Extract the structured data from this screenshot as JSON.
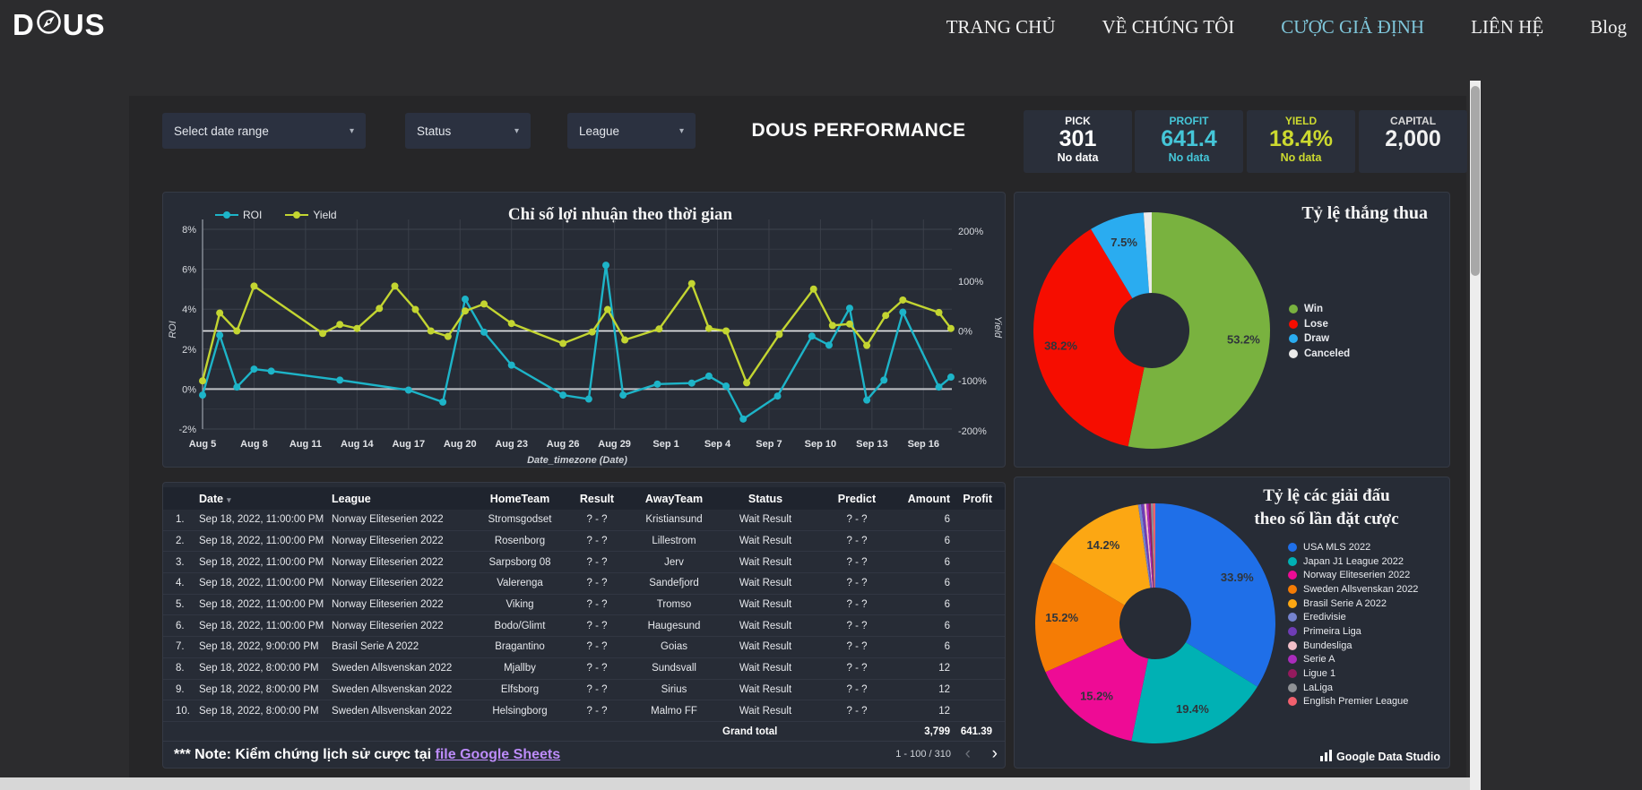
{
  "nav": {
    "logo_prefix": "D",
    "logo_suffix": "US",
    "items": [
      {
        "label": "TRANG CHỦ",
        "active": false
      },
      {
        "label": "VỀ CHÚNG TÔI",
        "active": false
      },
      {
        "label": "CƯỢC GIẢ ĐỊNH",
        "active": true
      },
      {
        "label": "LIÊN HỆ",
        "active": false
      },
      {
        "label": "Blog",
        "active": false
      }
    ]
  },
  "filters": [
    {
      "label": "Select date range",
      "caret": "▾"
    },
    {
      "label": "Status",
      "caret": "▾"
    },
    {
      "label": "League",
      "caret": "▾"
    }
  ],
  "dashboard_title": "DOUS PERFORMANCE",
  "kpis": [
    {
      "label": "PICK",
      "value": "301",
      "sub": "No data",
      "label_color": "#f4f4f4",
      "value_color": "#ffffff"
    },
    {
      "label": "PROFIT",
      "value": "641.4",
      "sub": "No data",
      "label_color": "#45c6d8",
      "value_color": "#45c6d8"
    },
    {
      "label": "YIELD",
      "value": "18.4%",
      "sub": "No data",
      "label_color": "#ccd92f",
      "value_color": "#ccd92f"
    },
    {
      "label": "CAPITAL",
      "value": "2,000",
      "sub": "",
      "label_color": "#d9d9d9",
      "value_color": "#f1f1f1"
    }
  ],
  "chart_data": [
    {
      "type": "line",
      "title": "Chỉ số lợi nhuận theo thời gian",
      "xlabel": "Date_timezone (Date)",
      "x_ticks": [
        "Aug 5",
        "Aug 8",
        "Aug 11",
        "Aug 14",
        "Aug 17",
        "Aug 20",
        "Aug 23",
        "Aug 26",
        "Aug 29",
        "Sep 1",
        "Sep 4",
        "Sep 7",
        "Sep 10",
        "Sep 13",
        "Sep 16"
      ],
      "x_tick_step_days": 3,
      "left_axis": {
        "label": "ROI",
        "tick_labels": [
          "8%",
          "6%",
          "4%",
          "2%",
          "0%",
          "-2%"
        ],
        "tick_values": [
          8,
          6,
          4,
          2,
          0,
          -2
        ],
        "min": -2,
        "max": 8
      },
      "right_axis": {
        "label": "Yield",
        "tick_labels": [
          "200%",
          "100%",
          "0%",
          "-100%",
          "-200%"
        ],
        "tick_values": [
          200,
          100,
          0,
          -100,
          -200
        ],
        "min": -200,
        "max": 200
      },
      "grid": true,
      "legend_position": "top-left",
      "series": [
        {
          "name": "ROI",
          "axis": "left",
          "color": "#1db4c8",
          "points": [
            [
              0,
              -0.3
            ],
            [
              1,
              2.7
            ],
            [
              2,
              0.1
            ],
            [
              3,
              1.0
            ],
            [
              4,
              0.9
            ],
            [
              8,
              0.45
            ],
            [
              12,
              -0.05
            ],
            [
              14,
              -0.65
            ],
            [
              15.3,
              4.5
            ],
            [
              16.4,
              2.85
            ],
            [
              18,
              1.2
            ],
            [
              21,
              -0.3
            ],
            [
              22.5,
              -0.5
            ],
            [
              23.5,
              6.2
            ],
            [
              24.5,
              -0.3
            ],
            [
              26.5,
              0.25
            ],
            [
              28.5,
              0.3
            ],
            [
              29.5,
              0.65
            ],
            [
              30.5,
              0.15
            ],
            [
              31.5,
              -1.5
            ],
            [
              33.5,
              -0.35
            ],
            [
              35.5,
              2.65
            ],
            [
              36.5,
              2.2
            ],
            [
              37.7,
              4.05
            ],
            [
              38.7,
              -0.55
            ],
            [
              39.7,
              0.45
            ],
            [
              40.8,
              3.85
            ],
            [
              42.9,
              0.1
            ],
            [
              43.6,
              0.6
            ]
          ]
        },
        {
          "name": "Yield",
          "axis": "right",
          "color": "#c3d531",
          "points": [
            [
              0,
              -100
            ],
            [
              1,
              36
            ],
            [
              2,
              0
            ],
            [
              3,
              90
            ],
            [
              7,
              -5
            ],
            [
              8,
              13
            ],
            [
              9,
              5
            ],
            [
              10.3,
              45
            ],
            [
              11.2,
              90
            ],
            [
              12.4,
              43
            ],
            [
              13.3,
              0
            ],
            [
              14.3,
              -11
            ],
            [
              15.3,
              40
            ],
            [
              16.4,
              54
            ],
            [
              18,
              15
            ],
            [
              21,
              -25
            ],
            [
              22.7,
              -2
            ],
            [
              23.6,
              43
            ],
            [
              24.6,
              -18
            ],
            [
              26.6,
              4
            ],
            [
              28.5,
              95
            ],
            [
              29.5,
              5
            ],
            [
              30.5,
              0
            ],
            [
              31.7,
              -104
            ],
            [
              33.6,
              -7
            ],
            [
              35.6,
              84
            ],
            [
              36.7,
              11
            ],
            [
              37.7,
              14
            ],
            [
              38.7,
              -29
            ],
            [
              39.8,
              31
            ],
            [
              40.8,
              62
            ],
            [
              42.9,
              37
            ],
            [
              43.6,
              5
            ]
          ]
        }
      ]
    },
    {
      "type": "donut",
      "title": "Tỷ lệ thắng thua",
      "legend_position": "right",
      "label_min_pct": 5,
      "slices": [
        {
          "label": "Win",
          "value": 53.2,
          "pct_label": "53.2%",
          "color": "#79b23f"
        },
        {
          "label": "Lose",
          "value": 38.2,
          "pct_label": "38.2%",
          "color": "#f60d00"
        },
        {
          "label": "Draw",
          "value": 7.5,
          "pct_label": "7.5%",
          "color": "#2aacf0"
        },
        {
          "label": "Canceled",
          "value": 1.1,
          "pct_label": "1.1%",
          "color": "#ebebeb"
        }
      ]
    },
    {
      "type": "donut",
      "title_lines": [
        "Tỷ lệ các giải đấu",
        "theo số lần đặt cược"
      ],
      "legend_position": "right",
      "label_min_pct": 5,
      "slices": [
        {
          "label": "USA MLS 2022",
          "value": 33.9,
          "pct_label": "33.9%",
          "color": "#1f6fe8"
        },
        {
          "label": "Japan J1 League 2022",
          "value": 19.4,
          "pct_label": "19.4%",
          "color": "#00b1b4"
        },
        {
          "label": "Norway Eliteserien 2022",
          "value": 15.2,
          "pct_label": "15.2%",
          "color": "#ee0b95"
        },
        {
          "label": "Sweden Allsvenskan 2022",
          "value": 15.2,
          "pct_label": "15.2%",
          "color": "#f57c05"
        },
        {
          "label": "Brasil Serie A 2022",
          "value": 14.2,
          "pct_label": "14.2%",
          "color": "#fca713"
        },
        {
          "label": "Eredivisie",
          "value": 0.4,
          "pct_label": "0.4%",
          "color": "#7583cf"
        },
        {
          "label": "Primeira Liga",
          "value": 0.4,
          "pct_label": "0.4%",
          "color": "#6f3cb5"
        },
        {
          "label": "Bundesliga",
          "value": 0.3,
          "pct_label": "0.3%",
          "color": "#f2bfc9"
        },
        {
          "label": "Serie A",
          "value": 0.3,
          "pct_label": "0.3%",
          "color": "#aa2cbc"
        },
        {
          "label": "Ligue 1",
          "value": 0.3,
          "pct_label": "0.3%",
          "color": "#951a5e"
        },
        {
          "label": "LaLiga",
          "value": 0.3,
          "pct_label": "0.3%",
          "color": "#909296"
        },
        {
          "label": "English Premier League",
          "value": 0.3,
          "pct_label": "0.3%",
          "color": "#f2606e"
        }
      ]
    }
  ],
  "table": {
    "headers": [
      "Date",
      "League",
      "HomeTeam",
      "Result",
      "AwayTeam",
      "Status",
      "Predict",
      "Amount",
      "Profit"
    ],
    "sort_icon": "▾",
    "rows": [
      [
        "1.",
        "Sep 18, 2022, 11:00:00 PM",
        "Norway Eliteserien 2022",
        "Stromsgodset",
        "? - ?",
        "Kristiansund",
        "Wait Result",
        "? - ?",
        "6",
        ""
      ],
      [
        "2.",
        "Sep 18, 2022, 11:00:00 PM",
        "Norway Eliteserien 2022",
        "Rosenborg",
        "? - ?",
        "Lillestrom",
        "Wait Result",
        "? - ?",
        "6",
        ""
      ],
      [
        "3.",
        "Sep 18, 2022, 11:00:00 PM",
        "Norway Eliteserien 2022",
        "Sarpsborg 08",
        "? - ?",
        "Jerv",
        "Wait Result",
        "? - ?",
        "6",
        ""
      ],
      [
        "4.",
        "Sep 18, 2022, 11:00:00 PM",
        "Norway Eliteserien 2022",
        "Valerenga",
        "? - ?",
        "Sandefjord",
        "Wait Result",
        "? - ?",
        "6",
        ""
      ],
      [
        "5.",
        "Sep 18, 2022, 11:00:00 PM",
        "Norway Eliteserien 2022",
        "Viking",
        "? - ?",
        "Tromso",
        "Wait Result",
        "? - ?",
        "6",
        ""
      ],
      [
        "6.",
        "Sep 18, 2022, 11:00:00 PM",
        "Norway Eliteserien 2022",
        "Bodo/Glimt",
        "? - ?",
        "Haugesund",
        "Wait Result",
        "? - ?",
        "6",
        ""
      ],
      [
        "7.",
        "Sep 18, 2022, 9:00:00 PM",
        "Brasil Serie A 2022",
        "Bragantino",
        "? - ?",
        "Goias",
        "Wait Result",
        "? - ?",
        "6",
        ""
      ],
      [
        "8.",
        "Sep 18, 2022, 8:00:00 PM",
        "Sweden Allsvenskan 2022",
        "Mjallby",
        "? - ?",
        "Sundsvall",
        "Wait Result",
        "? - ?",
        "12",
        ""
      ],
      [
        "9.",
        "Sep 18, 2022, 8:00:00 PM",
        "Sweden Allsvenskan 2022",
        "Elfsborg",
        "? - ?",
        "Sirius",
        "Wait Result",
        "? - ?",
        "12",
        ""
      ],
      [
        "10.",
        "Sep 18, 2022, 8:00:00 PM",
        "Sweden Allsvenskan 2022",
        "Helsingborg",
        "? - ?",
        "Malmo FF",
        "Wait Result",
        "? - ?",
        "12",
        ""
      ]
    ],
    "grand_total": {
      "label": "Grand total",
      "amount": "3,799",
      "profit": "641.39"
    }
  },
  "note": {
    "prefix": "*** Note: Kiểm chứng lịch sử cược tại ",
    "link_text": "file Google Sheets"
  },
  "pagination": {
    "range": "1 - 100 / 310",
    "prev": "‹",
    "next": "›"
  },
  "attribution": "Google Data Studio"
}
